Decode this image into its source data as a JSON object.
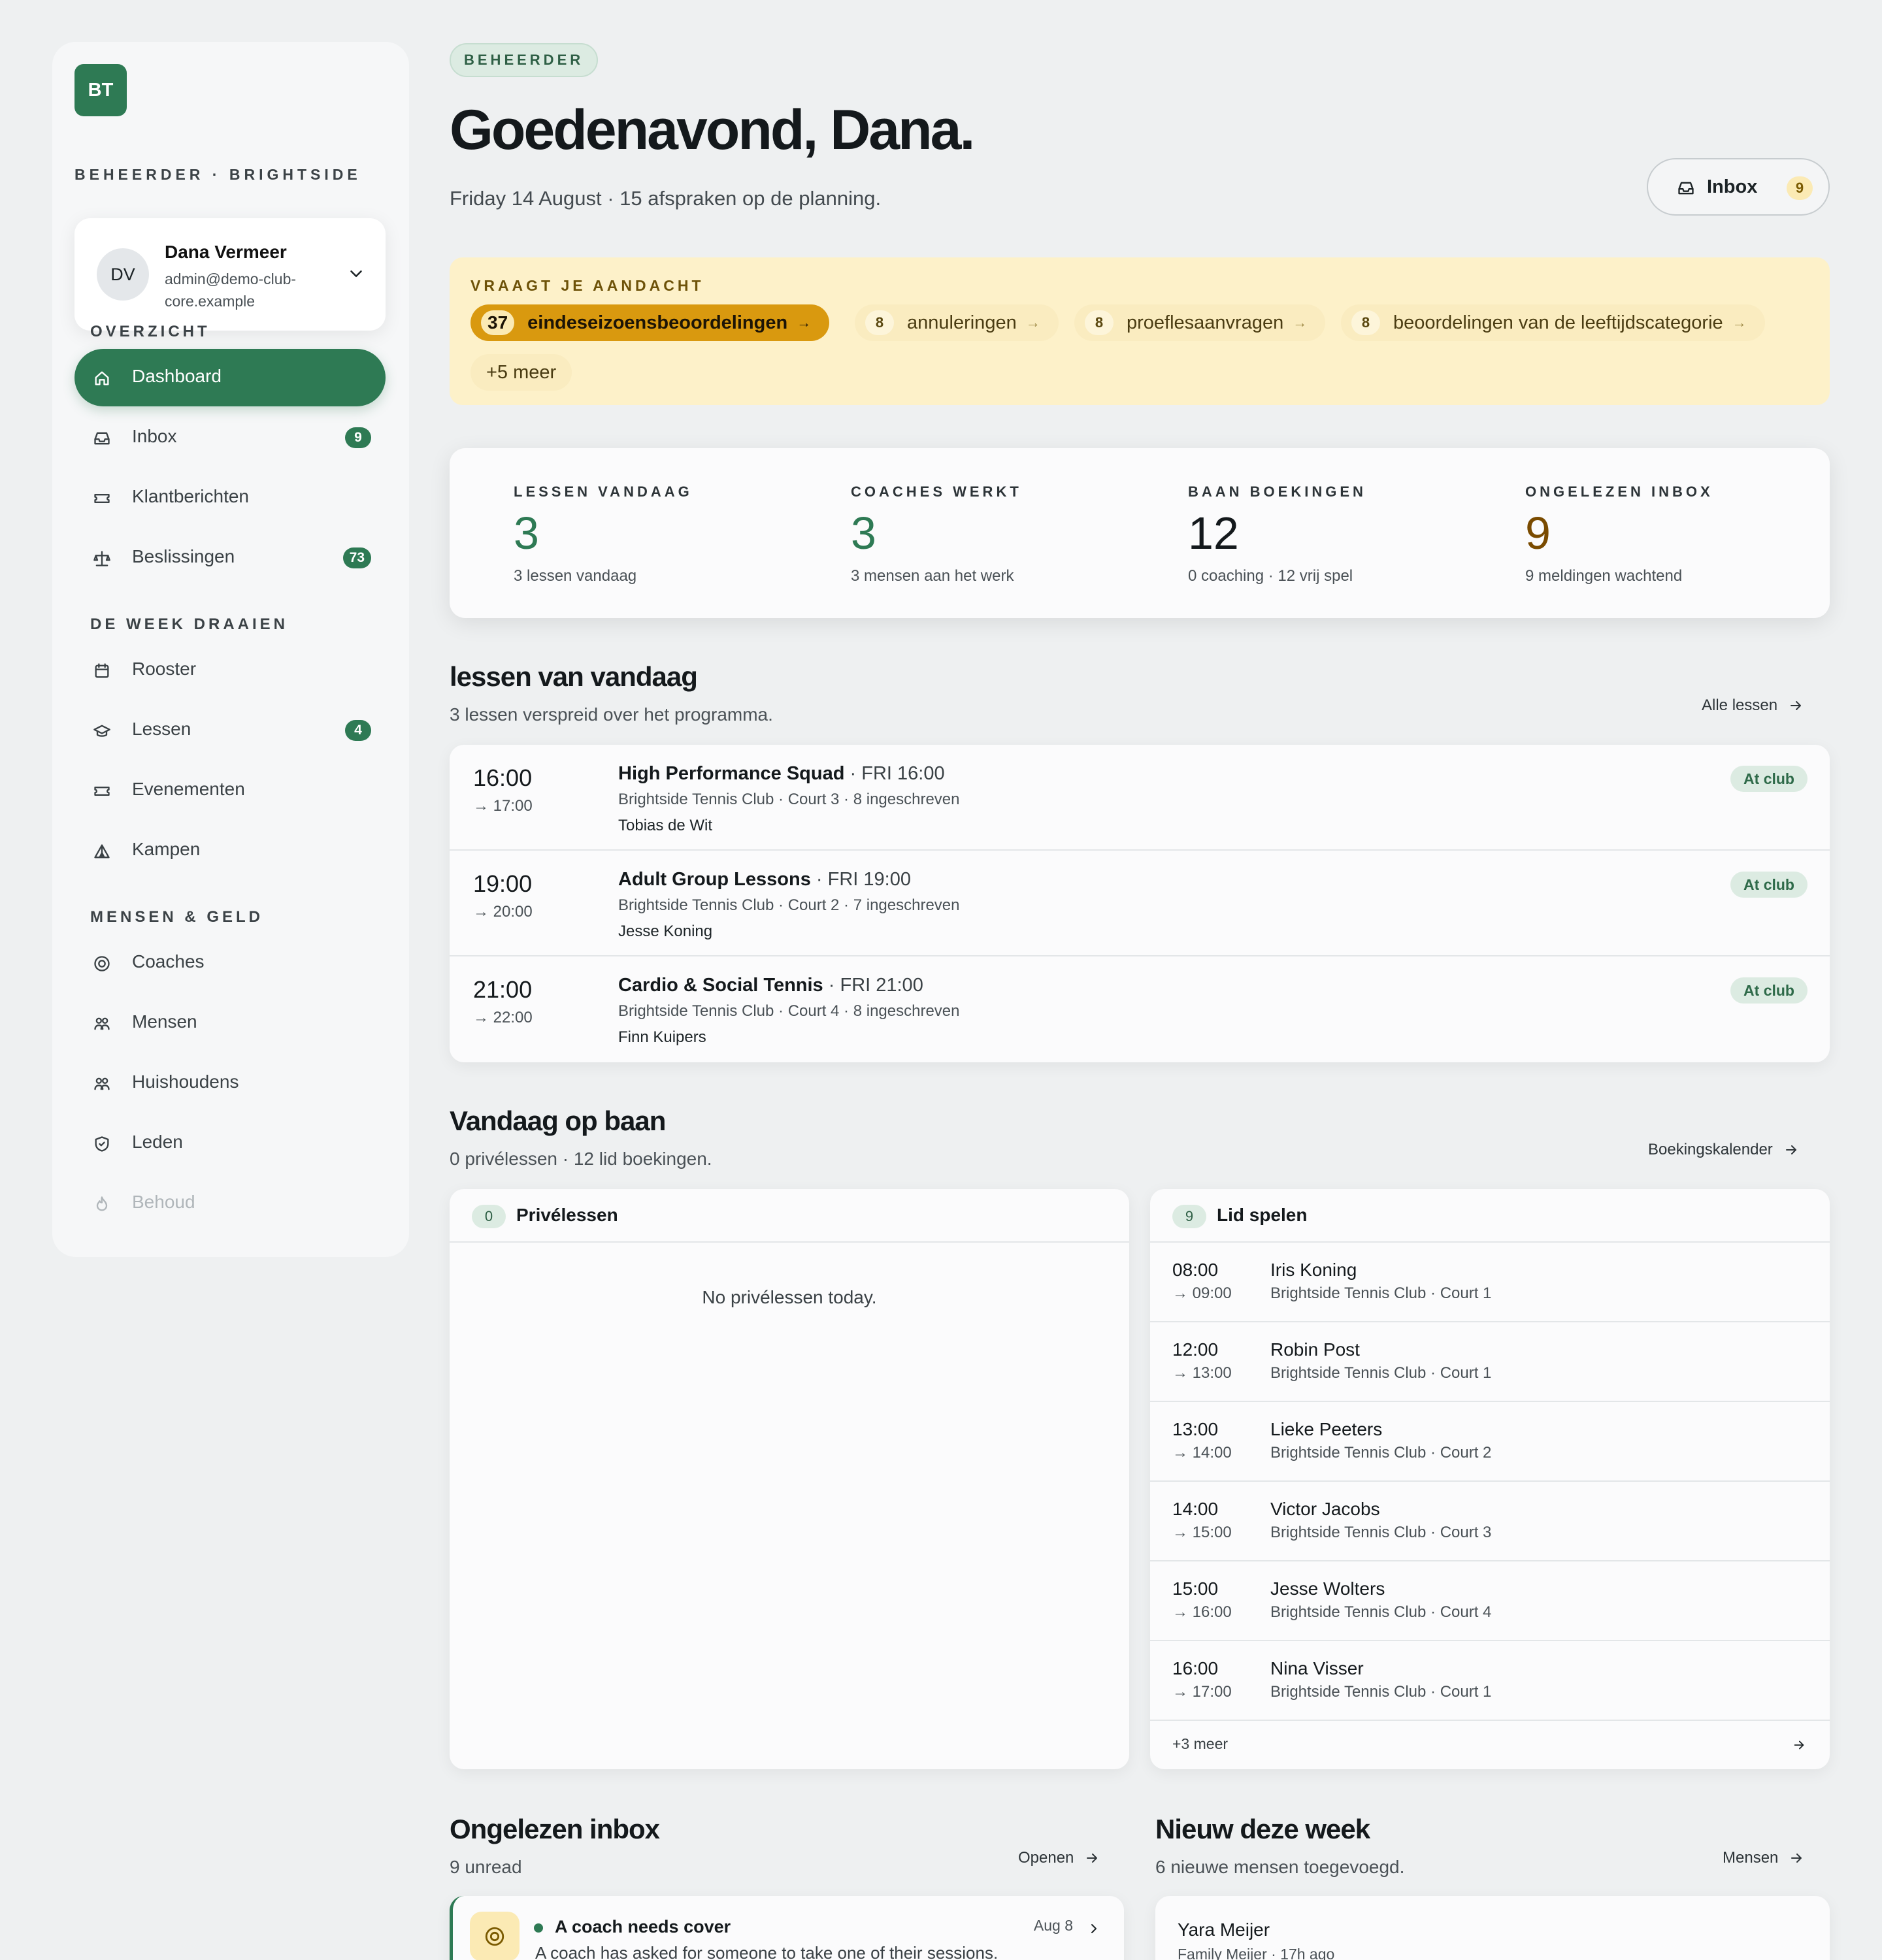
{
  "brand": {
    "logo": "BT",
    "name": "BEHEERDER · BRIGHTSIDE"
  },
  "user": {
    "initials": "DV",
    "name": "Dana Vermeer",
    "email": "admin@demo-club-core.example"
  },
  "sidebar": {
    "sections": [
      {
        "title": "OVERZICHT"
      },
      {
        "title": "DE WEEK DRAAIEN"
      },
      {
        "title": "MENSEN & GELD"
      }
    ],
    "items": [
      {
        "label": "Dashboard",
        "icon": "home-icon",
        "active": true
      },
      {
        "label": "Inbox",
        "icon": "inbox-icon",
        "badge": "9"
      },
      {
        "label": "Klantberichten",
        "icon": "ticket-icon"
      },
      {
        "label": "Beslissingen",
        "icon": "scale-icon",
        "badge": "73"
      },
      {
        "label": "Rooster",
        "icon": "calendar-icon"
      },
      {
        "label": "Lessen",
        "icon": "graduation-icon",
        "badge": "4"
      },
      {
        "label": "Evenementen",
        "icon": "ticket-icon"
      },
      {
        "label": "Kampen",
        "icon": "tent-icon"
      },
      {
        "label": "Coaches",
        "icon": "target-icon"
      },
      {
        "label": "Mensen",
        "icon": "people-icon"
      },
      {
        "label": "Huishoudens",
        "icon": "people-icon"
      },
      {
        "label": "Leden",
        "icon": "shield-icon"
      },
      {
        "label": "Behoud",
        "icon": "flame-icon"
      }
    ]
  },
  "header": {
    "role": "BEHEERDER",
    "greeting": "Goedenavond, Dana.",
    "subline": "Friday 14 August · 15 afspraken op de planning.",
    "inbox_label": "Inbox",
    "inbox_count": "9"
  },
  "attention": {
    "title": "VRAAGT JE AANDACHT",
    "chips": [
      {
        "count": "37",
        "label": "eindeseizoensbeoordelingen"
      },
      {
        "count": "8",
        "label": "annuleringen"
      },
      {
        "count": "8",
        "label": "proeflesaanvragen"
      },
      {
        "count": "8",
        "label": "beoordelingen van de leeftijdscategorie"
      }
    ],
    "more": "+5 meer"
  },
  "stats": [
    {
      "label": "LESSEN VANDAAG",
      "value": "3",
      "sub": "3 lessen vandaag"
    },
    {
      "label": "COACHES WERKT",
      "value": "3",
      "sub": "3 mensen aan het werk"
    },
    {
      "label": "BAAN BOEKINGEN",
      "value": "12",
      "sub": "0 coaching · 12 vrij spel"
    },
    {
      "label": "ONGELEZEN INBOX",
      "value": "9",
      "sub": "9 meldingen wachtend"
    }
  ],
  "lessons": {
    "title": "lessen van vandaag",
    "sub": "3 lessen verspreid over het programma.",
    "link": "Alle lessen",
    "items": [
      {
        "start": "16:00",
        "end": "→ 17:00",
        "name": "High Performance Squad",
        "slot": " · FRI 16:00",
        "meta": "Brightside Tennis Club · Court 3 · 8 ingeschreven",
        "coach": "Tobias de Wit",
        "badge": "At club"
      },
      {
        "start": "19:00",
        "end": "→ 20:00",
        "name": "Adult Group Lessons",
        "slot": " · FRI 19:00",
        "meta": "Brightside Tennis Club · Court 2 · 7 ingeschreven",
        "coach": "Jesse Koning",
        "badge": "At club"
      },
      {
        "start": "21:00",
        "end": "→ 22:00",
        "name": "Cardio & Social Tennis",
        "slot": " · FRI 21:00",
        "meta": "Brightside Tennis Club · Court 4 · 8 ingeschreven",
        "coach": "Finn Kuipers",
        "badge": "At club"
      }
    ]
  },
  "courts": {
    "title": "Vandaag op baan",
    "sub": "0 privélessen · 12 lid boekingen.",
    "link": "Boekingskalender",
    "private": {
      "count": "0",
      "title": "Privélessen",
      "empty": "No privélessen today."
    },
    "member": {
      "count": "9",
      "title": "Lid spelen",
      "bookings": [
        {
          "start": "08:00",
          "end": "→ 09:00",
          "name": "Iris Koning",
          "court": "Brightside Tennis Club · Court 1"
        },
        {
          "start": "12:00",
          "end": "→ 13:00",
          "name": "Robin Post",
          "court": "Brightside Tennis Club · Court 1"
        },
        {
          "start": "13:00",
          "end": "→ 14:00",
          "name": "Lieke Peeters",
          "court": "Brightside Tennis Club · Court 2"
        },
        {
          "start": "14:00",
          "end": "→ 15:00",
          "name": "Victor Jacobs",
          "court": "Brightside Tennis Club · Court 3"
        },
        {
          "start": "15:00",
          "end": "→ 16:00",
          "name": "Jesse Wolters",
          "court": "Brightside Tennis Club · Court 4"
        },
        {
          "start": "16:00",
          "end": "→ 17:00",
          "name": "Nina Visser",
          "court": "Brightside Tennis Club · Court 1"
        }
      ],
      "more": "+3 meer"
    }
  },
  "unread": {
    "title": "Ongelezen inbox",
    "sub": "9 unread",
    "link": "Openen",
    "item": {
      "title": "A coach needs cover",
      "body": "A coach has asked for someone to take one of their sessions.",
      "date": "Aug 8"
    }
  },
  "newweek": {
    "title": "Nieuw deze week",
    "sub": "6 nieuwe mensen toegevoegd.",
    "link": "Mensen",
    "item": {
      "name": "Yara Meijer",
      "meta": "Family Meijer · 17h ago"
    }
  }
}
